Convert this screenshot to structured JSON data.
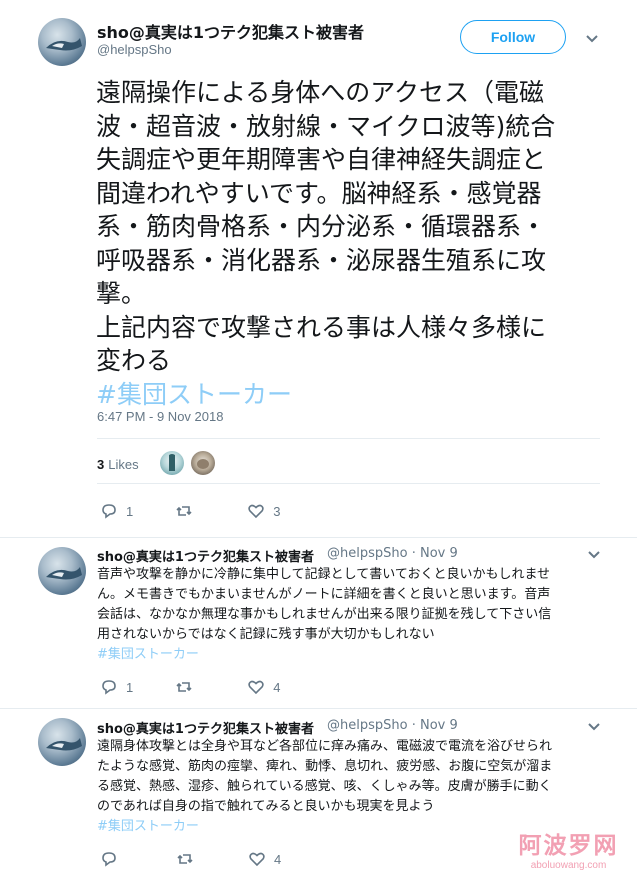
{
  "tweet": {
    "author_name": "sho@真実は1つテク犯集スト被害者",
    "author_handle": "@helpspSho",
    "follow_label": "Follow",
    "text_lines": [
      "遠隔操作による身体へのアクセス（電磁",
      "波・超音波・放射線・マイクロ波等)統合",
      "失調症や更年期障害や自律神経失調症と",
      "間違われやすいです。脳神経系・感覚器",
      "系・筋肉骨格系・内分泌系・循環器系・",
      "呼吸器系・消化器系・泌尿器生殖系に攻",
      "撃。",
      "上記内容で攻撃される事は人様々多様に",
      "変わる"
    ],
    "hashtag": "#集団ストーカー",
    "timestamp": "6:47 PM - 9 Nov 2018",
    "likes_count": "3",
    "likes_label": "Likes",
    "replies": "1",
    "likes": "3"
  },
  "replies": [
    {
      "author_name": "sho@真実は1つテク犯集スト被害者",
      "meta": "@helpspSho · Nov 9",
      "text_lines": [
        "音声や攻撃を静かに冷静に集中して記録として書いておくと良いかもしれませ",
        "ん。メモ書きでもかまいませんがノートに詳細を書くと良いと思います。音声",
        "会話は、なかなか無理な事かもしれませんが出来る限り証拠を残して下さい信",
        "用されないからではなく記録に残す事が大切かもしれない"
      ],
      "hashtag": "#集団ストーカー",
      "replies": "1",
      "likes": "4"
    },
    {
      "author_name": "sho@真実は1つテク犯集スト被害者",
      "meta": "@helpspSho · Nov 9",
      "text_lines": [
        "遠隔身体攻撃とは全身や耳など各部位に痒み痛み、電磁波で電流を浴びせられ",
        "たような感覚、筋肉の痙攣、痺れ、動悸、息切れ、疲労感、お腹に空気が溜ま",
        "る感覚、熱感、湿疹、触られている感覚、咳、くしゃみ等。皮膚が勝手に動く",
        "のであれば自身の指で触れてみると良いかも現実を見よう"
      ],
      "hashtag": "#集団ストーカー",
      "replies": "",
      "likes": "4"
    }
  ],
  "watermark": {
    "main": "阿波罗网",
    "sub": "aboluowang.com"
  },
  "colors": {
    "accent": "#1da1f2",
    "muted": "#657786",
    "text": "#14171a",
    "divider": "#e6ecf0"
  }
}
